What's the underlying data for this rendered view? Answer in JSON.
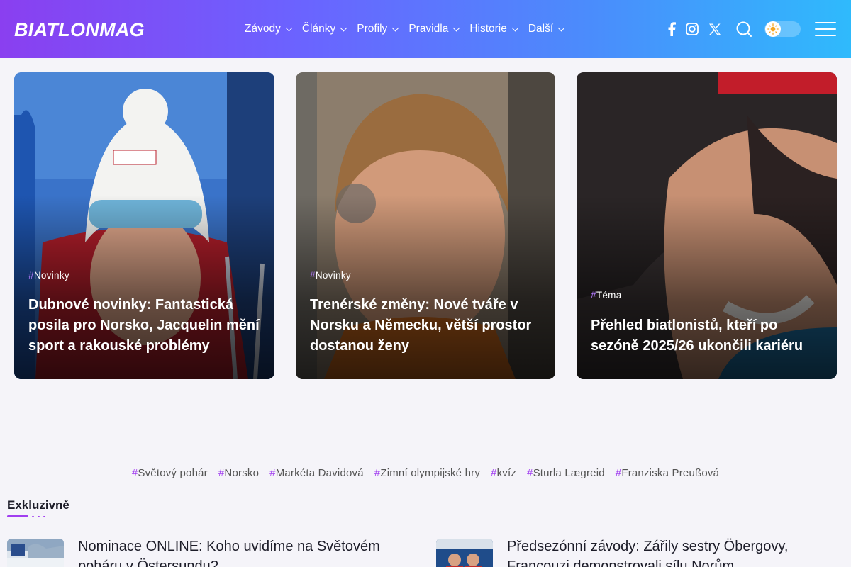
{
  "brand": {
    "logo": "BIATLONMAG"
  },
  "nav": {
    "items": [
      {
        "label": "Závody"
      },
      {
        "label": "Články"
      },
      {
        "label": "Profily"
      },
      {
        "label": "Pravidla"
      },
      {
        "label": "Historie"
      },
      {
        "label": "Další"
      }
    ]
  },
  "header_icons": [
    "facebook-icon",
    "instagram-icon",
    "x-icon",
    "search-icon",
    "theme-toggle",
    "menu-icon"
  ],
  "colors": {
    "accent": "#a13ef0",
    "header_gradient": [
      "#8a3ff0",
      "#2fbafc"
    ],
    "background": "#f5f4f9"
  },
  "cards": [
    {
      "tag": "Novinky",
      "title": "Dubnové novinky: Fantastická posila pro Norsko, Jacquelin mění sport a rakouské problémy"
    },
    {
      "tag": "Novinky",
      "title": "Trenérské změny: Nové tváře v Norsku a Německu, větší prostor dostanou ženy"
    },
    {
      "tag": "Téma",
      "title": "Přehled biatlonistů, kteří po sezóně 2025/26 ukončili kariéru"
    }
  ],
  "tags": [
    "Světový pohár",
    "Norsko",
    "Markéta Davidová",
    "Zimní olympijské hry",
    "kvíz",
    "Sturla Lægreid",
    "Franziska Preußová"
  ],
  "tag_hash": "#",
  "section": {
    "title": "Exkluzivně"
  },
  "posts": [
    {
      "title": "Nominace ONLINE: Koho uvidíme na Světovém poháru v Östersundu?"
    },
    {
      "title": "Předsezónní závody: Zářily sestry Öbergovy, Francouzi demonstrovali sílu Norům"
    }
  ]
}
